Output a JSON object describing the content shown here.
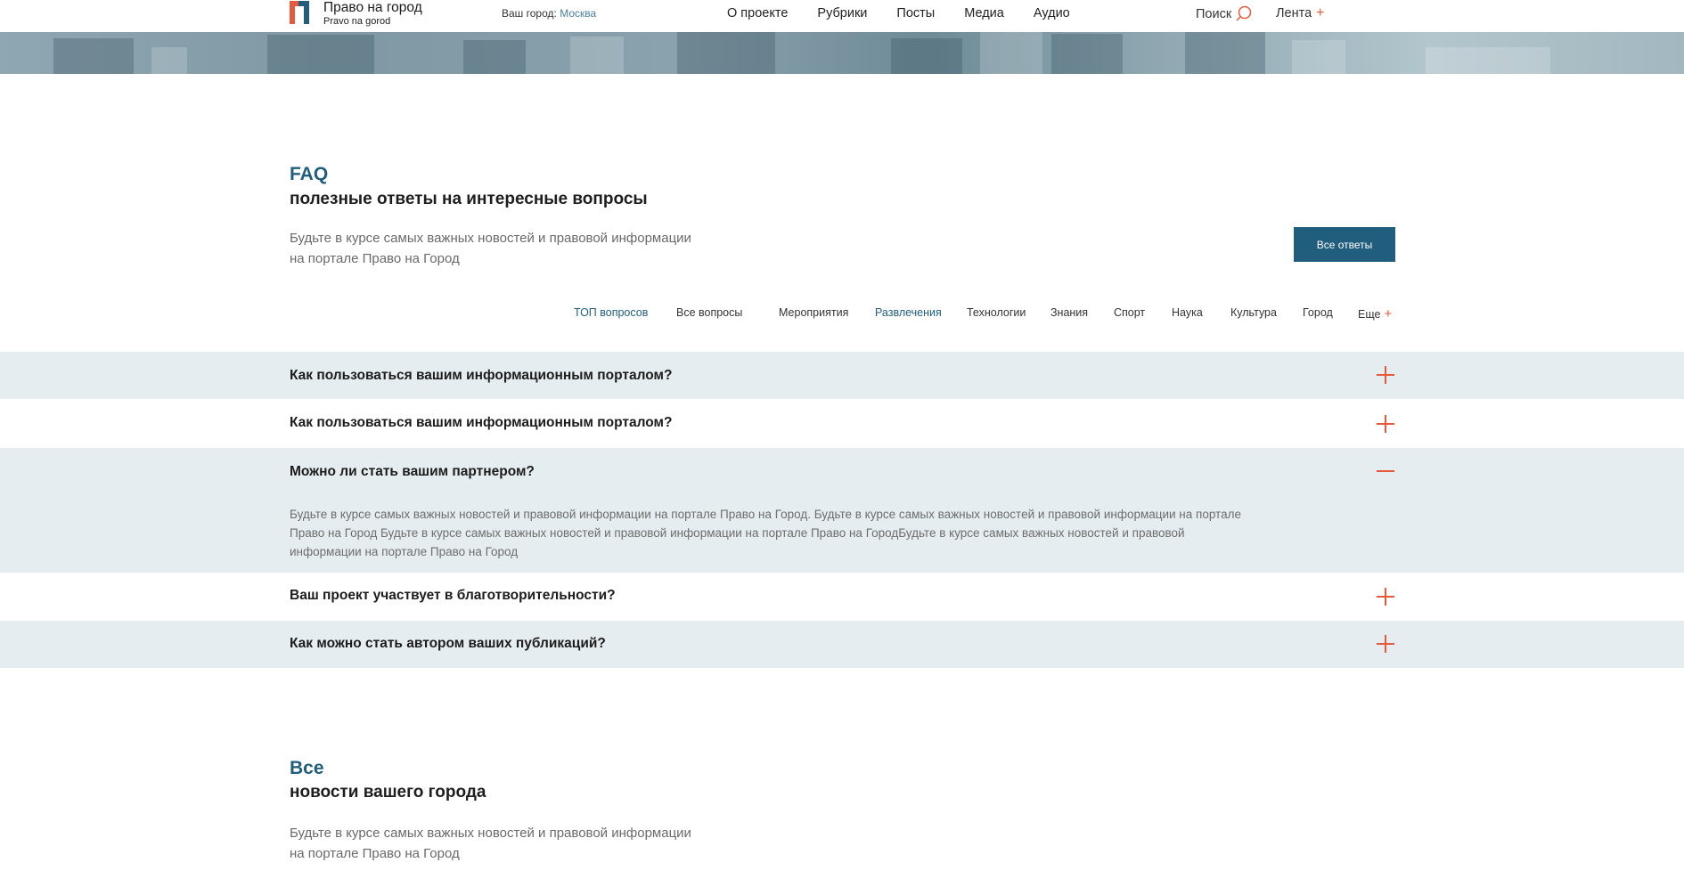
{
  "header": {
    "logo_name": "Право на город",
    "logo_sub": "Pravo na gorod",
    "city_label": "Ваш город:",
    "city_value": "Москва",
    "nav": [
      "О проекте",
      "Рубрики",
      "Посты",
      "Медиа",
      "Аудио"
    ],
    "search_label": "Поиск",
    "feed_label": "Лента",
    "accent_color": "#e45a3a",
    "brand_color": "#215e7e"
  },
  "faq": {
    "title": "FAQ",
    "subtitle": "полезные ответы на интересные вопросы",
    "description_line1": "Будьте в курсе самых важных новостей и правовой информации",
    "description_line2": "на портале Право на Город",
    "all_answers_button": "Все ответы",
    "tabs": [
      "ТОП вопросов",
      "Все вопросы",
      "Мероприятия",
      "Развлечения",
      "Технологии",
      "Знания",
      "Спорт",
      "Наука",
      "Культура",
      "Город",
      "Еще"
    ],
    "active_tabs": [
      "ТОП вопросов",
      "Развлечения"
    ],
    "items": [
      {
        "question": "Как пользоваться вашим информационным порталом?",
        "expanded": false
      },
      {
        "question": "Как пользоваться вашим информационным порталом?",
        "expanded": false
      },
      {
        "question": "Можно ли стать вашим партнером?",
        "expanded": true,
        "answer": "Будьте в курсе самых важных новостей и правовой информации на портале Право на Город. Будьте в курсе самых важных новостей и правовой информации на портале Право на Город Будьте в курсе самых важных новостей и правовой информации на портале Право на ГородБудьте в курсе самых важных новостей и правовой информации на портале Право на Город"
      },
      {
        "question": "Ваш проект участвует в благотворительности?",
        "expanded": false
      },
      {
        "question": "Как можно стать автором ваших публикаций?",
        "expanded": false
      }
    ]
  },
  "news": {
    "title": "Все",
    "subtitle": "новости вашего города",
    "description_line1": "Будьте в курсе самых важных новостей и правовой информации",
    "description_line2": "на портале Право на Город"
  }
}
